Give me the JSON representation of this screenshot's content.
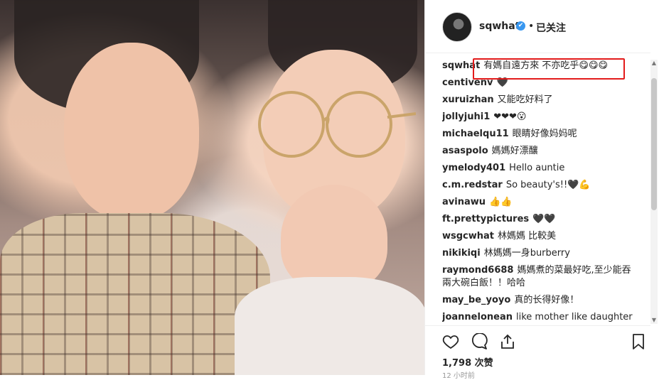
{
  "post": {
    "username": "sqwhat",
    "verified_mark": "✔",
    "follow_label": "已关注",
    "caption_username": "sqwhat",
    "caption_text": "有媽自遠方來 不亦吃乎😋😋😋",
    "highlight_color": "#e31b1b",
    "accent_blue": "#3897f0"
  },
  "comments": [
    {
      "user": "sqwhat",
      "text": "有媽自遠方來 不亦吃乎😋😋😋"
    },
    {
      "user": "centivenv",
      "text": "🖤"
    },
    {
      "user": "xuruizhan",
      "text": "又能吃好料了"
    },
    {
      "user": "jollyjuhi1",
      "text": "❤❤❤😮"
    },
    {
      "user": "michaelqu11",
      "text": "眼睛好像妈妈呢"
    },
    {
      "user": "asaspolo",
      "text": "媽媽好漂釀"
    },
    {
      "user": "ymelody401",
      "text": "Hello auntie"
    },
    {
      "user": "c.m.redstar",
      "text": "So beauty's!!🖤💪"
    },
    {
      "user": "avinawu",
      "text": "👍👍"
    },
    {
      "user": "ft.prettypictures",
      "text": "🖤🖤"
    },
    {
      "user": "wsgcwhat",
      "text": "林媽媽 比較美"
    },
    {
      "user": "nikikiqi",
      "text": "林媽媽一身burberry"
    },
    {
      "user": "raymond6688",
      "text": "媽媽煮的菜最好吃,至少能吞兩大碗白飯！！哈哈"
    },
    {
      "user": "may_be_yoyo",
      "text": "真的长得好像！"
    },
    {
      "user": "joannelonean",
      "text": "like mother like daughter"
    }
  ],
  "actions": {
    "like_icon": "heart-icon",
    "comment_icon": "comment-icon",
    "share_icon": "share-icon",
    "save_icon": "bookmark-icon",
    "likes_text": "1,798 次赞",
    "timestamp_cutoff": "12 小时前"
  }
}
